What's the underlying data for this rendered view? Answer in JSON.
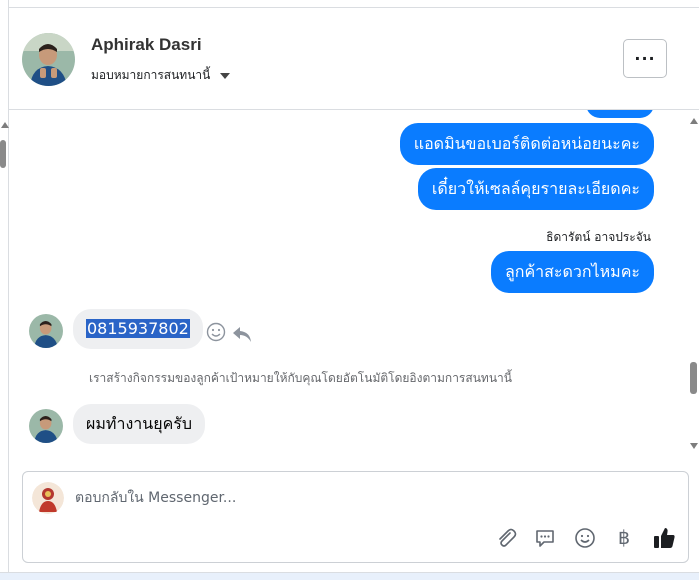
{
  "header": {
    "contact_name": "Aphirak Dasri",
    "assign_label": "มอบหมายการสนทนานี้",
    "more_label": "···"
  },
  "thread": {
    "messages_out": [
      {
        "text": "แอดมินขอเบอร์ติดต่อหน่อยนะคะ"
      },
      {
        "text": "เดี๋ยวให้เซลล์คุยรายละเอียดคะ"
      },
      {
        "text": "ลูกค้าสะดวกไหมคะ"
      }
    ],
    "sender_name": "ธิดารัตน์ อาจประจัน",
    "messages_in": [
      {
        "text": "0815937802"
      },
      {
        "text": "ผมทำงานยุครับ"
      }
    ],
    "system_note": "เราสร้างกิจกรรมของลูกค้าเป้าหมายให้กับคุณโดยอัตโนมัติโดยอิงตามการสนทนานี้"
  },
  "composer": {
    "placeholder": "ตอบกลับใน Messenger...",
    "currency_symbol": "฿"
  },
  "colors": {
    "accent": "#0a7cff",
    "incoming_bubble": "#eeeff1",
    "selection": "#2a64c7"
  }
}
